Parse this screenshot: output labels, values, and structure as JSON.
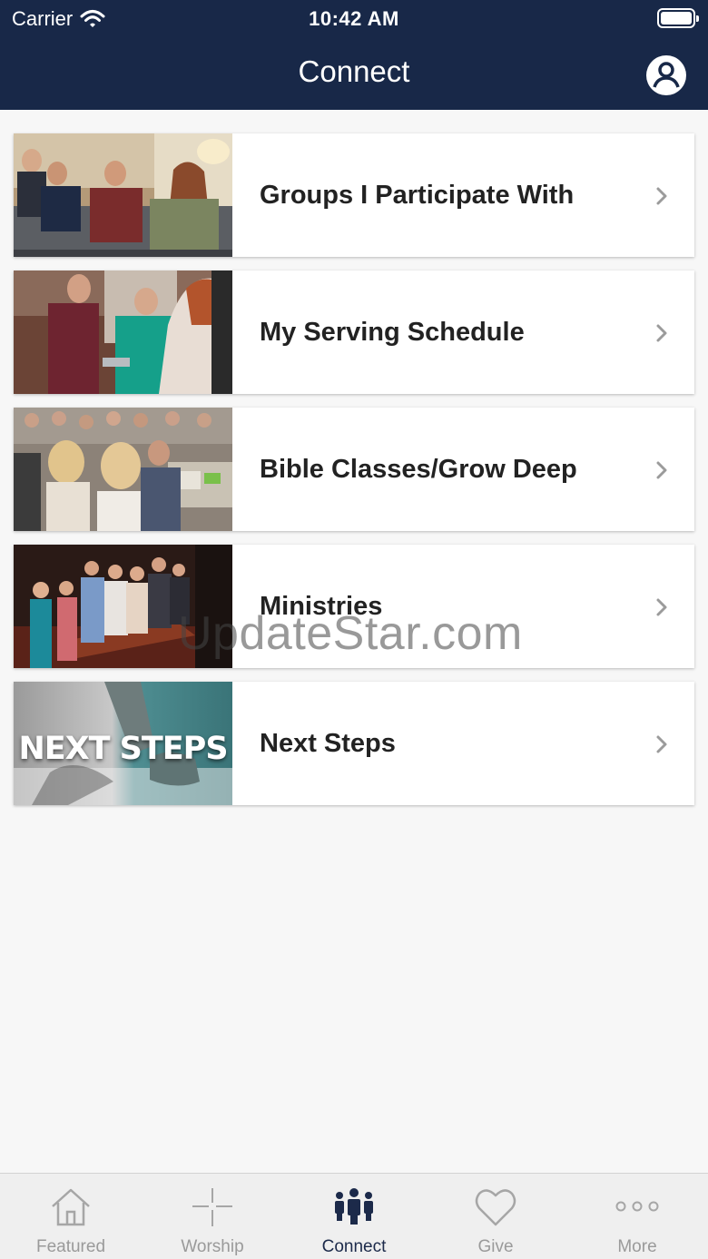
{
  "status_bar": {
    "carrier": "Carrier",
    "time": "10:42 AM"
  },
  "header": {
    "title": "Connect",
    "profile_icon": "user-circle-icon",
    "background_color": "#182848"
  },
  "items": [
    {
      "label": "Groups I Participate With",
      "thumbnail": "group-photo"
    },
    {
      "label": "My Serving Schedule",
      "thumbnail": "serving-photo"
    },
    {
      "label": "Bible Classes/Grow Deep",
      "thumbnail": "class-photo"
    },
    {
      "label": "Ministries",
      "thumbnail": "choir-photo"
    },
    {
      "label": "Next Steps",
      "thumbnail": "next-steps-graphic",
      "thumbnail_text": "NEXT STEPS"
    }
  ],
  "watermark": "UpdateStar.com",
  "tabbar": {
    "tabs": [
      {
        "label": "Featured",
        "icon": "home-icon",
        "active": false
      },
      {
        "label": "Worship",
        "icon": "cross-icon",
        "active": false
      },
      {
        "label": "Connect",
        "icon": "people-icon",
        "active": true
      },
      {
        "label": "Give",
        "icon": "heart-icon",
        "active": false
      },
      {
        "label": "More",
        "icon": "more-dots-icon",
        "active": false
      }
    ],
    "active_color": "#1c2a4a",
    "inactive_color": "#9a9a9a"
  }
}
